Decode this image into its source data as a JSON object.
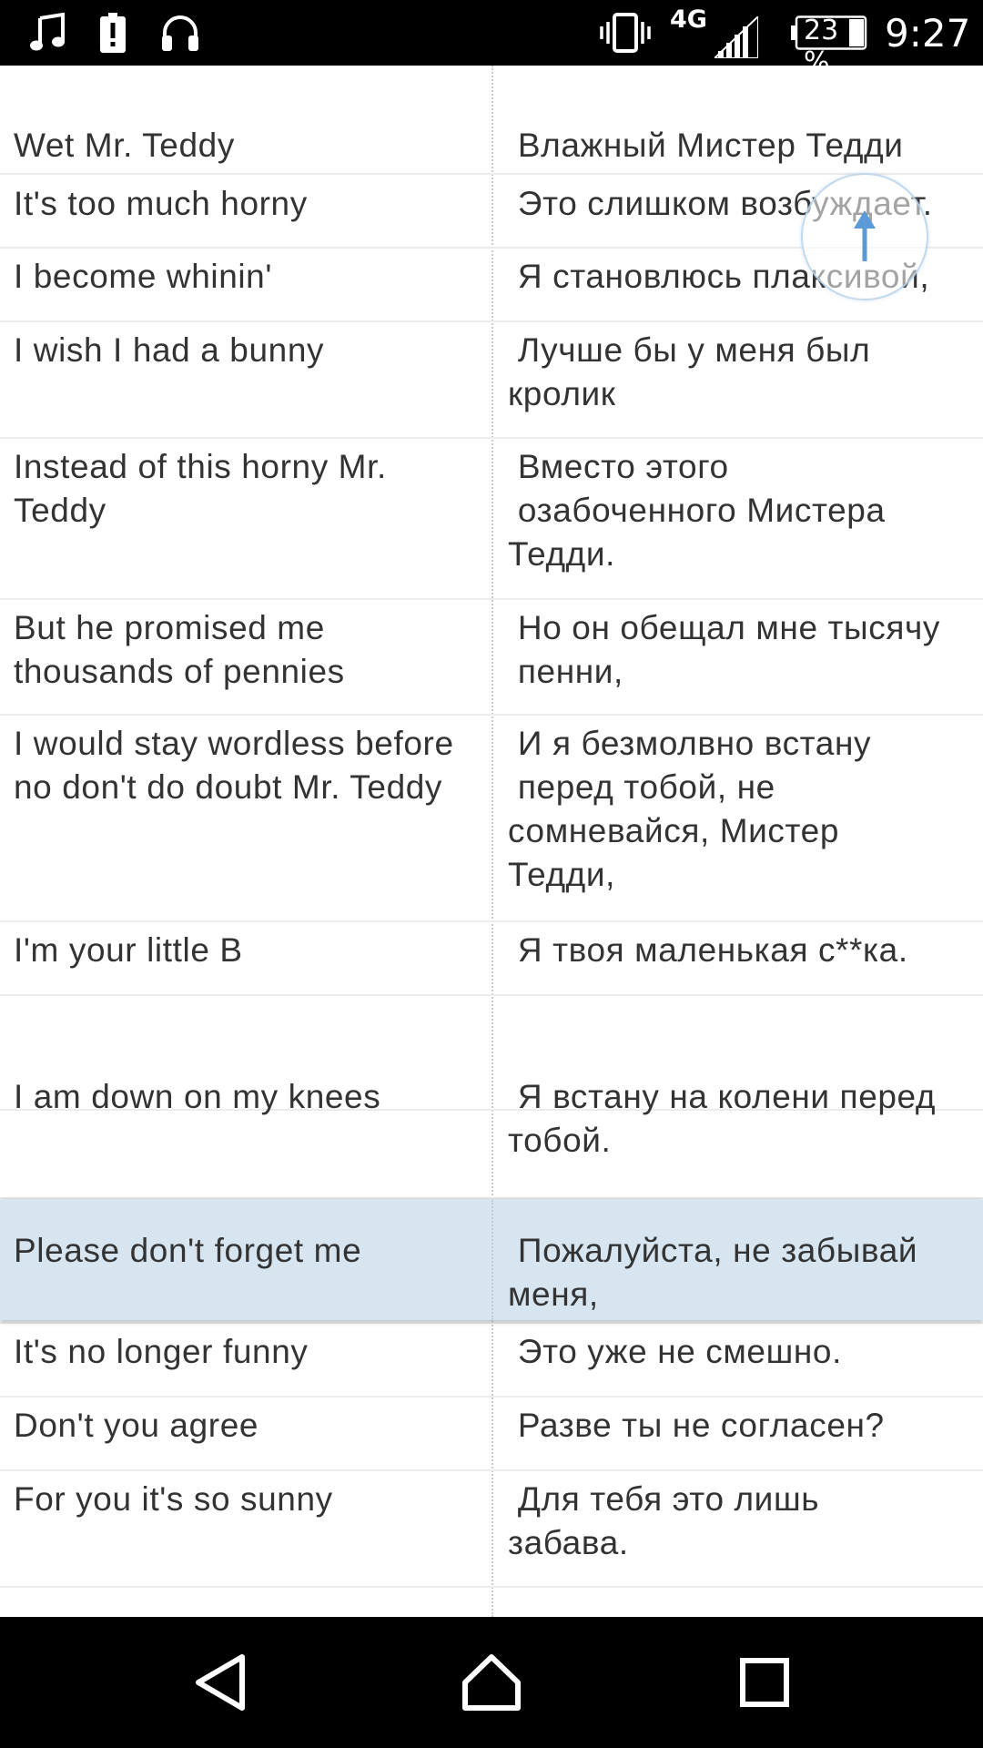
{
  "status_bar": {
    "icons": [
      "music-note-icon",
      "battery-saver-icon",
      "headphones-icon",
      "vibrate-icon",
      "signal-icon",
      "battery-icon"
    ],
    "network": "4G",
    "battery": "23 %",
    "time": "9:27"
  },
  "lyrics": [
    {
      "en": "Wet Mr. Teddy",
      "ru": " Влажный Мистер Тедди"
    },
    {
      "en": "It's too much horny",
      "ru": " Это слишком возбуждает."
    },
    {
      "en": "I become whinin'",
      "ru": " Я становлюсь плаксивой,"
    },
    {
      "en": "I wish I had a bunny",
      "ru": " Лучше бы у меня был\nкролик"
    },
    {
      "en": "Instead of this horny Mr.\nTeddy",
      "ru": " Вместо этого\n озабоченного Мистера\nТедди."
    },
    {
      "en": "But he promised me\nthousands of pennies",
      "ru": " Но он обещал мне тысячу\n пенни,"
    },
    {
      "en": "I would stay wordless before\nno don't do doubt Mr. Teddy",
      "ru": " И я безмолвно встану\n перед тобой, не\nсомневайся, Мистер\nТедди,"
    },
    {
      "en": "I'm your little B",
      "ru": " Я твоя маленькая с**ка."
    },
    {
      "en": "",
      "ru": ""
    },
    {
      "en": "I am down on my knees",
      "ru": " Я встану на колени перед\nтобой."
    },
    {
      "en": "",
      "ru": ""
    },
    {
      "en": "Please don't forget me",
      "ru": " Пожалуйста, не забывай\nменя,"
    },
    {
      "en": "It's no longer funny",
      "ru": " Это уже не смешно."
    },
    {
      "en": "Don't you agree",
      "ru": " Разве ты не согласен?"
    },
    {
      "en": "For you it's so sunny",
      "ru": " Для тебя это лишь\nзабава."
    }
  ],
  "nav_bar": {
    "buttons": [
      "back-icon",
      "home-icon",
      "recents-icon"
    ]
  },
  "colors": {
    "highlight_row": "#d7e5f0",
    "scroll_arrow": "#5a9ad6"
  }
}
